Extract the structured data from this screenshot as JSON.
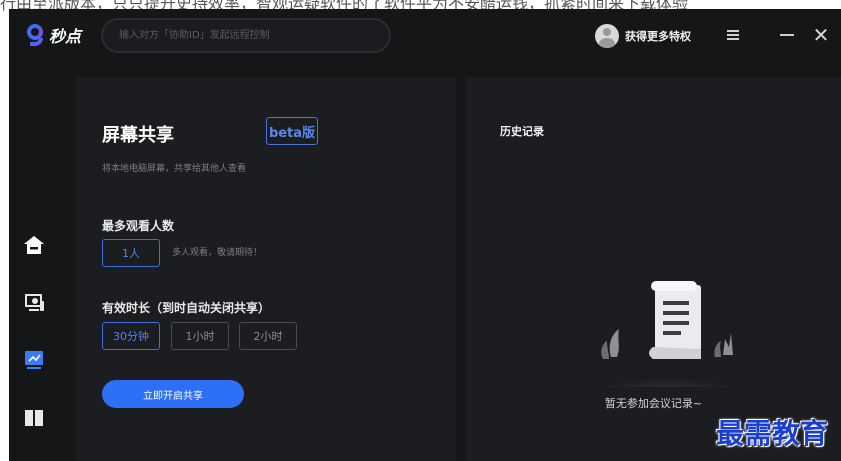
{
  "caption": "行由至派版本，只只提升史持效率，智观运疑软件的了软件平为不安醋运钱，抓紧时间来下载体验",
  "app": {
    "name": "秒点",
    "search": {
      "value": "",
      "placeholder": "输入对方「协助ID」发起远程控制"
    },
    "profile": {
      "label": "获得更多特权"
    }
  },
  "screen_share": {
    "title": "屏幕共享",
    "badge": "beta版",
    "subtitle": "将本地电脑屏幕，共享给其他人查看",
    "max_viewers": {
      "label": "最多观看人数",
      "option": "1人",
      "hint": "多人观看，敬请期待！"
    },
    "duration": {
      "label": "有效时长（到时自动关闭共享）",
      "options": [
        "30分钟",
        "1小时",
        "2小时"
      ],
      "selected": "30分钟"
    },
    "start_button": "立即开启共享"
  },
  "history": {
    "title": "历史记录",
    "empty_text": "暂无参加会议记录~"
  },
  "watermark": "最需教育",
  "colors": {
    "background": "#151618",
    "panel": "#1c1d20",
    "accent": "#2d6ff6",
    "accent_text": "#4f84f2"
  },
  "icons": {
    "sidebar": [
      "home-icon",
      "remote-desktop-icon",
      "screen-share-icon",
      "book-icon"
    ],
    "window": [
      "menu-icon",
      "minimize-icon",
      "close-icon"
    ]
  }
}
